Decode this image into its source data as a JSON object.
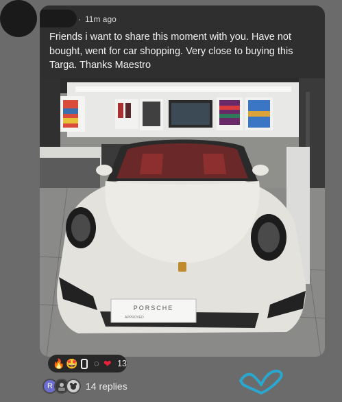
{
  "post": {
    "timestamp": "11m ago",
    "text": "Friends i want to share this moment with you. Have not bought, went for car shopping. Very close to buying this Targa. Thanks Maestro"
  },
  "photo": {
    "plate_brand": "PORSCHE",
    "plate_sub": "APPROVED"
  },
  "reactions": {
    "items": [
      {
        "icon": "fire-icon",
        "glyph": "🔥"
      },
      {
        "icon": "star-struck-icon",
        "glyph": "🤩"
      },
      {
        "icon": "ghost-square-icon",
        "glyph": ""
      },
      {
        "icon": "spinner-icon",
        "glyph": "◌"
      },
      {
        "icon": "heart-icon",
        "glyph": "❤"
      }
    ],
    "count": "13"
  },
  "replies": {
    "avatar_initial": "R",
    "label": "14 replies"
  },
  "colors": {
    "page_bg": "#6b6b6b",
    "card_bg": "#2f2f2f",
    "heart_scribble": "#2aa7cf"
  }
}
